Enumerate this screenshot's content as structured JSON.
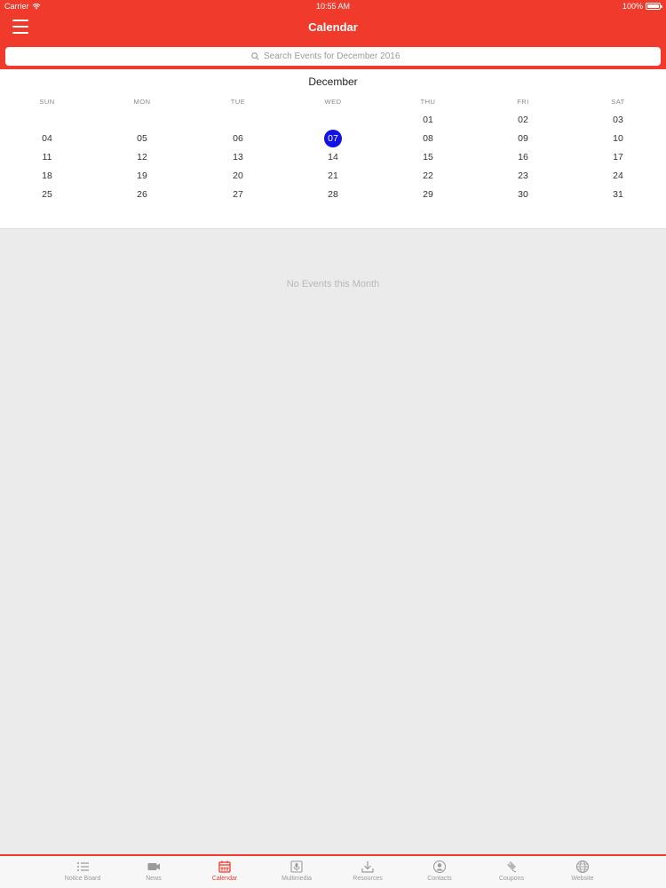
{
  "status": {
    "carrier": "Carrier",
    "time": "10:55 AM",
    "battery": "100%"
  },
  "nav": {
    "title": "Calendar"
  },
  "search": {
    "placeholder": "Search Events for December 2016"
  },
  "calendar": {
    "month": "December",
    "weekdays": [
      "SUN",
      "MON",
      "TUE",
      "WED",
      "THU",
      "FRI",
      "SAT"
    ],
    "first_weekday_index": 4,
    "days_in_month": 31,
    "today": "07",
    "today_color": "#1212e8"
  },
  "empty_message": "No Events this Month",
  "tabs": [
    {
      "label": "Notice Board",
      "icon": "list-icon",
      "active": false
    },
    {
      "label": "News",
      "icon": "video-icon",
      "active": false
    },
    {
      "label": "Calendar",
      "icon": "calendar-icon",
      "active": true
    },
    {
      "label": "Multimedia",
      "icon": "microphone-icon",
      "active": false
    },
    {
      "label": "Resources",
      "icon": "download-icon",
      "active": false
    },
    {
      "label": "Contacts",
      "icon": "person-icon",
      "active": false
    },
    {
      "label": "Coupons",
      "icon": "tag-icon",
      "active": false
    },
    {
      "label": "Website",
      "icon": "globe-icon",
      "active": false
    }
  ],
  "colors": {
    "accent": "#f03a2b",
    "background": "#ebebeb"
  }
}
